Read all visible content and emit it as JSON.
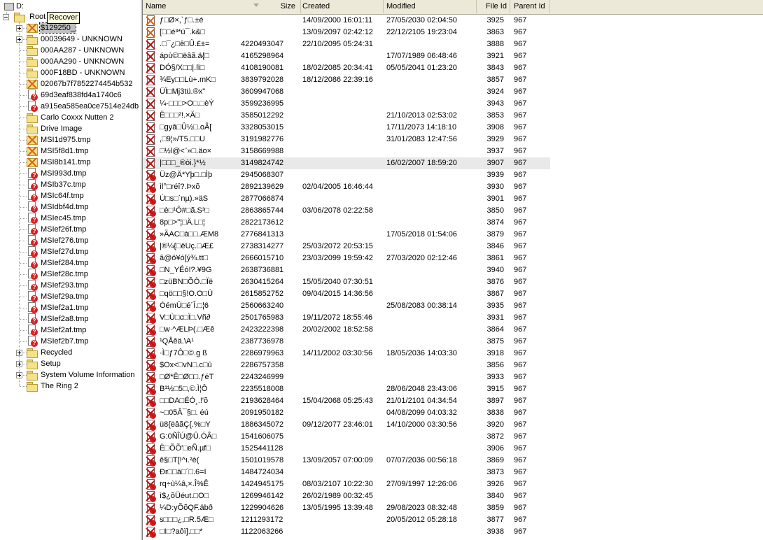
{
  "tree": {
    "drive_label": "D:",
    "root_label": "Root",
    "tooltip": "Recover",
    "items": [
      {
        "label": "$129250_",
        "icon": "deleted",
        "expander": "plus",
        "selected": true
      },
      {
        "label": "00039649 - UNKNOWN",
        "icon": "folder",
        "expander": "plus"
      },
      {
        "label": "000AA287 - UNKNOWN",
        "icon": "folder",
        "expander": ""
      },
      {
        "label": "000AA290 - UNKNOWN",
        "icon": "folder",
        "expander": ""
      },
      {
        "label": "000F18BD - UNKNOWN",
        "icon": "folder",
        "expander": ""
      },
      {
        "label": "02067b7f7852274454b532",
        "icon": "deleted",
        "expander": ""
      },
      {
        "label": "69d3eaf838fd4a1740c6",
        "icon": "question",
        "expander": ""
      },
      {
        "label": "a915ea585ea0ce7514e24db",
        "icon": "question",
        "expander": ""
      },
      {
        "label": "Carlo Coxxx Nutten 2",
        "icon": "folder",
        "expander": ""
      },
      {
        "label": "Drive Image",
        "icon": "folder",
        "expander": ""
      },
      {
        "label": "MSI1d975.tmp",
        "icon": "deleted",
        "expander": ""
      },
      {
        "label": "MSI5f8d1.tmp",
        "icon": "deleted",
        "expander": ""
      },
      {
        "label": "MSI8b141.tmp",
        "icon": "deleted",
        "expander": ""
      },
      {
        "label": "MSI993d.tmp",
        "icon": "question",
        "expander": ""
      },
      {
        "label": "MSIb37c.tmp",
        "icon": "question",
        "expander": ""
      },
      {
        "label": "MSIc64f.tmp",
        "icon": "question",
        "expander": ""
      },
      {
        "label": "MSIdbf4d.tmp",
        "icon": "question",
        "expander": ""
      },
      {
        "label": "MSIec45.tmp",
        "icon": "question",
        "expander": ""
      },
      {
        "label": "MSIef26f.tmp",
        "icon": "question",
        "expander": ""
      },
      {
        "label": "MSIef276.tmp",
        "icon": "question",
        "expander": ""
      },
      {
        "label": "MSIef27d.tmp",
        "icon": "question",
        "expander": ""
      },
      {
        "label": "MSIef284.tmp",
        "icon": "question",
        "expander": ""
      },
      {
        "label": "MSIef28c.tmp",
        "icon": "question",
        "expander": ""
      },
      {
        "label": "MSIef293.tmp",
        "icon": "question",
        "expander": ""
      },
      {
        "label": "MSIef29a.tmp",
        "icon": "question",
        "expander": ""
      },
      {
        "label": "MSIef2a1.tmp",
        "icon": "question",
        "expander": ""
      },
      {
        "label": "MSIef2a8.tmp",
        "icon": "question",
        "expander": ""
      },
      {
        "label": "MSIef2af.tmp",
        "icon": "question",
        "expander": ""
      },
      {
        "label": "MSIef2b7.tmp",
        "icon": "question",
        "expander": ""
      },
      {
        "label": "Recycled",
        "icon": "folder",
        "expander": "plus"
      },
      {
        "label": "Setup",
        "icon": "folder",
        "expander": "plus"
      },
      {
        "label": "System Volume Information",
        "icon": "folder",
        "expander": "plus"
      },
      {
        "label": "The Ring 2",
        "icon": "folder",
        "expander": ""
      }
    ]
  },
  "columns": {
    "name": "Name",
    "size": "Size",
    "created": "Created",
    "modified": "Modified",
    "file_id": "File Id",
    "parent_id": "Parent Id"
  },
  "files": [
    {
      "icon": "deleted-orange",
      "name": "ƒ□Ø×,`ƒ□.±é",
      "size": "",
      "created": "14/09/2000 16:01:11",
      "modified": "27/05/2030 02:04:50",
      "file_id": "3925",
      "parent_id": "967"
    },
    {
      "icon": "deleted-orange",
      "name": "[□□é³*ú¯.k&□",
      "size": "",
      "created": "13/09/2097 02:42:12",
      "modified": "22/12/2105 19:23:04",
      "file_id": "3863",
      "parent_id": "967"
    },
    {
      "icon": "deleted",
      "name": ".□¯¿□ê□Û.£±=",
      "size": "4220493047",
      "created": "22/10/2095 05:24:31",
      "modified": "",
      "file_id": "3888",
      "parent_id": "967"
    },
    {
      "icon": "deleted",
      "name": "ápù©□ëâã.ä{□",
      "size": "4165298964",
      "created": "",
      "modified": "17/07/1989 06:48:46",
      "file_id": "3921",
      "parent_id": "967"
    },
    {
      "icon": "deleted",
      "name": "DÓ§/X□□|.lï□",
      "size": "4108190081",
      "created": "18/02/2085 20:34:41",
      "modified": "05/05/2041 01:23:20",
      "file_id": "3843",
      "parent_id": "967"
    },
    {
      "icon": "deleted",
      "name": "¾Ey□□Lù+.mK□",
      "size": "3839792028",
      "created": "18/12/2086 22:39:16",
      "modified": "",
      "file_id": "3857",
      "parent_id": "967"
    },
    {
      "icon": "deleted",
      "name": "ÜÏ□Mj3tü.®x\"",
      "size": "3609947068",
      "created": "",
      "modified": "",
      "file_id": "3924",
      "parent_id": "967"
    },
    {
      "icon": "deleted",
      "name": "¼-□□□>O□.□èÝ",
      "size": "3599236995",
      "created": "",
      "modified": "",
      "file_id": "3943",
      "parent_id": "967"
    },
    {
      "icon": "deleted",
      "name": "Ë□□□²!.×Ä□",
      "size": "3585012292",
      "created": "",
      "modified": "21/10/2013 02:53:02",
      "file_id": "3853",
      "parent_id": "967"
    },
    {
      "icon": "deleted",
      "name": "□gyâ□Û½□.oÂ[",
      "size": "3328053015",
      "created": "",
      "modified": "17/11/2073 14:18:10",
      "file_id": "3908",
      "parent_id": "967"
    },
    {
      "icon": "deleted",
      "name": ",□9¦»/T5.□□U",
      "size": "3191982776",
      "created": "",
      "modified": "31/01/2083 12:47:56",
      "file_id": "3929",
      "parent_id": "967"
    },
    {
      "icon": "deleted",
      "name": "□½l@<¨»□.äo×",
      "size": "3158669988",
      "created": "",
      "modified": "",
      "file_id": "3937",
      "parent_id": "967"
    },
    {
      "icon": "deleted",
      "name": "|□□□_®òi.}*½",
      "size": "3149824742",
      "created": "",
      "modified": "16/02/2007 18:59:20",
      "file_id": "3907",
      "parent_id": "967",
      "highlight": true
    },
    {
      "icon": "question",
      "name": "Üz@Ä*Yþ□.□Ìþ",
      "size": "2945068307",
      "created": "",
      "modified": "",
      "file_id": "3939",
      "parent_id": "967"
    },
    {
      "icon": "question",
      "name": "ìl°□réî?.Þxõ",
      "size": "2892139629",
      "created": "02/04/2005 16:46:44",
      "modified": "",
      "file_id": "3930",
      "parent_id": "967"
    },
    {
      "icon": "question",
      "name": "Ú□s□`nµ).»äS",
      "size": "2877066874",
      "created": "",
      "modified": "",
      "file_id": "3901",
      "parent_id": "967"
    },
    {
      "icon": "question",
      "name": "□è□¹Ô#□ã.S³□",
      "size": "2863865744",
      "created": "03/06/2078 02:22:58",
      "modified": "",
      "file_id": "3850",
      "parent_id": "967"
    },
    {
      "icon": "question",
      "name": "8p□>\"¦□Ä.L□¦",
      "size": "2822173612",
      "created": "",
      "modified": "",
      "file_id": "3874",
      "parent_id": "967"
    },
    {
      "icon": "question",
      "name": "»ÄAC□à□□.ÆM8",
      "size": "2776841313",
      "created": "",
      "modified": "17/05/2018 01:54:06",
      "file_id": "3879",
      "parent_id": "967"
    },
    {
      "icon": "question",
      "name": "|®¼{□ëUç.□Æ£",
      "size": "2738314277",
      "created": "25/03/2072 20:53:15",
      "modified": "",
      "file_id": "3846",
      "parent_id": "967"
    },
    {
      "icon": "question",
      "name": "â@ö¥ó[ý¾.tt□",
      "size": "2666015710",
      "created": "23/03/2099 19:59:42",
      "modified": "27/03/2020 02:12:46",
      "file_id": "3861",
      "parent_id": "967"
    },
    {
      "icon": "question",
      "name": "□N_YÉó!?.¥9G",
      "size": "2638736881",
      "created": "",
      "modified": "",
      "file_id": "3940",
      "parent_id": "967"
    },
    {
      "icon": "question",
      "name": "□züBN□ÕÒ.□Ïë",
      "size": "2630415264",
      "created": "15/05/2040 07:30:51",
      "modified": "",
      "file_id": "3876",
      "parent_id": "967"
    },
    {
      "icon": "question",
      "name": "□qö□□§!O.O□Ú",
      "size": "2615852752",
      "created": "09/04/2015 14:36:56",
      "modified": "",
      "file_id": "3867",
      "parent_id": "967"
    },
    {
      "icon": "question",
      "name": "ÓémÛ□é´Î.□¦6",
      "size": "2560663240",
      "created": "",
      "modified": "25/08/2083 00:38:14",
      "file_id": "3935",
      "parent_id": "967"
    },
    {
      "icon": "question",
      "name": "V□Ù□c□Ï□.Vñ∂",
      "size": "2501765983",
      "created": "19/11/2072 18:55:46",
      "modified": "",
      "file_id": "3931",
      "parent_id": "967"
    },
    {
      "icon": "question",
      "name": "□w·^ÆLÞ(.□Æê",
      "size": "2423222398",
      "created": "20/02/2002 18:52:58",
      "modified": "",
      "file_id": "3864",
      "parent_id": "967"
    },
    {
      "icon": "question",
      "name": "¹QÅêä.\\A¹",
      "size": "2387736978",
      "created": "",
      "modified": "",
      "file_id": "3875",
      "parent_id": "967"
    },
    {
      "icon": "question",
      "name": "·Ì□ƒ7Ô□©.g ß",
      "size": "2286979963",
      "created": "14/11/2002 03:30:56",
      "modified": "18/05/2036 14:03:30",
      "file_id": "3918",
      "parent_id": "967"
    },
    {
      "icon": "question",
      "name": "$Ox<□vN□.c□û",
      "size": "2286757358",
      "created": "",
      "modified": "",
      "file_id": "3856",
      "parent_id": "967"
    },
    {
      "icon": "question",
      "name": "□Ø*Ë□Ø□□.ƒéT",
      "size": "2243246999",
      "created": "",
      "modified": "",
      "file_id": "3933",
      "parent_id": "967"
    },
    {
      "icon": "question",
      "name": "B³½□5□,©.Ì¦Ô",
      "size": "2235518008",
      "created": "",
      "modified": "28/06/2048 23:43:06",
      "file_id": "3915",
      "parent_id": "967"
    },
    {
      "icon": "question",
      "name": "□□DA□ÉÓ¸.!'õ",
      "size": "2193628464",
      "created": "15/04/2068 05:25:43",
      "modified": "21/01/2101 04:34:54",
      "file_id": "3897",
      "parent_id": "967"
    },
    {
      "icon": "question",
      "name": "~□05Â¯§□. éú",
      "size": "2091950182",
      "created": "",
      "modified": "04/08/2099 04:03:32",
      "file_id": "3838",
      "parent_id": "967"
    },
    {
      "icon": "question",
      "name": "ü8{ëâãÇ{.%□Y",
      "size": "1886345072",
      "created": "09/12/2077 23:46:01",
      "modified": "14/10/2000 03:30:56",
      "file_id": "3920",
      "parent_id": "967"
    },
    {
      "icon": "question",
      "name": "G:0ÑÎÚ@Û.ÓÂ□",
      "size": "1541606075",
      "created": "",
      "modified": "",
      "file_id": "3872",
      "parent_id": "967"
    },
    {
      "icon": "question",
      "name": "Ë□ÕÕ'□eÑ.µf□",
      "size": "1525441128",
      "created": "",
      "modified": "",
      "file_id": "3906",
      "parent_id": "967"
    },
    {
      "icon": "question",
      "name": "ê§□T[!^ı.²è(",
      "size": "1501019578",
      "created": "13/09/2057 07:00:09",
      "modified": "07/07/2036 00:56:18",
      "file_id": "3869",
      "parent_id": "967"
    },
    {
      "icon": "question",
      "name": "Ðr□□ä□´□.6=I",
      "size": "1484724034",
      "created": "",
      "modified": "",
      "file_id": "3873",
      "parent_id": "967"
    },
    {
      "icon": "question",
      "name": "rq÷ù¼â,×.Î%Ê",
      "size": "1424945175",
      "created": "08/03/2107 10:22:30",
      "modified": "27/09/1997 12:26:06",
      "file_id": "3926",
      "parent_id": "967"
    },
    {
      "icon": "question",
      "name": "ì$¿õÜéut.□O□",
      "size": "1269946142",
      "created": "26/02/1989 00:32:45",
      "modified": "",
      "file_id": "3840",
      "parent_id": "967"
    },
    {
      "icon": "question",
      "name": "¼D:yÕõQF.äbð",
      "size": "1229904626",
      "created": "13/05/1995 13:39:48",
      "modified": "29/08/2023 08:32:48",
      "file_id": "3859",
      "parent_id": "967"
    },
    {
      "icon": "question",
      "name": "s□□□¿,□R.5Æ□",
      "size": "1211293172",
      "created": "",
      "modified": "20/05/2012 05:28:18",
      "file_id": "3877",
      "parent_id": "967"
    },
    {
      "icon": "question",
      "name": "□I□?aôì].□□*",
      "size": "1122063266",
      "created": "",
      "modified": "",
      "file_id": "3938",
      "parent_id": "967"
    }
  ]
}
